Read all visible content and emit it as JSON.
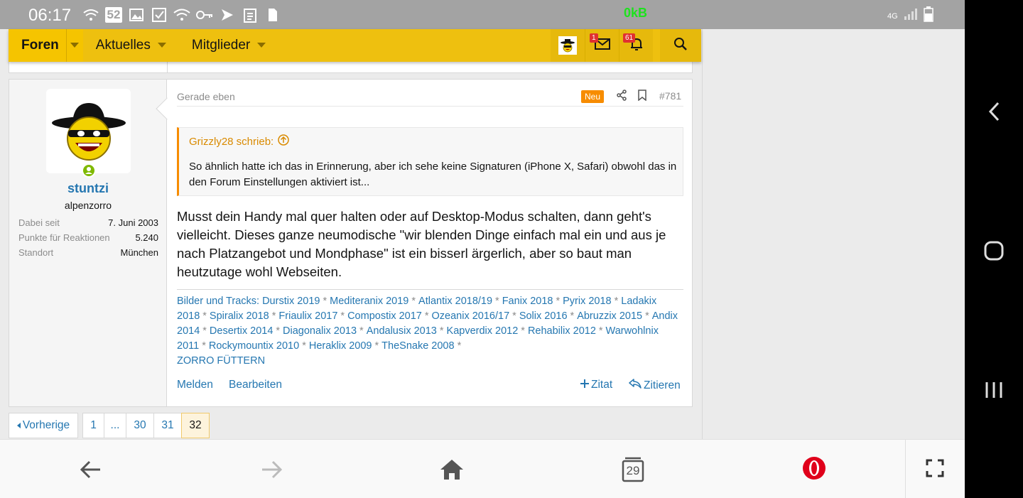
{
  "status_bar": {
    "time": "06:17",
    "notif_badge": "52",
    "net_speed": "0kB",
    "net_type": "4G",
    "icons": [
      "wifi-icon",
      "image-icon",
      "check-icon",
      "wifi-alt-icon",
      "key-icon",
      "send-icon",
      "clipboard-icon",
      "sim-icon"
    ]
  },
  "forum_nav": {
    "items": [
      {
        "label": "Foren"
      },
      {
        "label": "Aktuelles"
      },
      {
        "label": "Mitglieder"
      }
    ],
    "inbox_badge": "1",
    "alerts_badge": "61"
  },
  "post": {
    "date": "Gerade eben",
    "new_badge": "Neu",
    "post_number": "#781",
    "user": {
      "name": "stuntzi",
      "title": "alpenzorro",
      "extras": [
        {
          "key": "Dabei seit",
          "value": "7. Juni 2003"
        },
        {
          "key": "Punkte für Reaktionen",
          "value": "5.240"
        },
        {
          "key": "Standort",
          "value": "München"
        }
      ]
    },
    "quote": {
      "author_line": "Grizzly28 schrieb:",
      "text": "So ähnlich hatte ich das in Erinnerung, aber ich sehe keine Signaturen (iPhone X, Safari) obwohl das in den Forum Einstellungen aktiviert ist..."
    },
    "body": "Musst dein Handy mal quer halten oder auf Desktop-Modus schalten, dann geht's vielleicht. Dieses ganze neumodische \"wir blenden Dinge einfach mal ein und aus je nach Platzangebot und Mondphase\" ist ein bisserl ärgerlich, aber so baut man heutzutage wohl Webseiten.",
    "signature_links": [
      "Bilder und Tracks: Durstix 2019",
      "Mediteranix 2019",
      "Atlantix 2018/19",
      "Fanix 2018",
      "Pyrix 2018",
      "Ladakix 2018",
      "Spiralix 2018",
      "Friaulix 2017",
      "Compostix 2017",
      "Ozeanix 2016/17",
      "Solix 2016",
      "Abruzzix 2015",
      "Andix 2014",
      "Desertix 2014",
      "Diagonalix 2013",
      "Andalusix 2013",
      "Kapverdix 2012",
      "Rehabilix 2012",
      "Warwohlnix 2011",
      "Rockymountix 2010",
      "Heraklix 2009",
      "TheSnake 2008"
    ],
    "signature_separator": "*",
    "signature_last": "ZORRO FÜTTERN",
    "actions": {
      "report": "Melden",
      "edit": "Bearbeiten",
      "multiquote": "Zitat",
      "reply": "Zitieren"
    }
  },
  "pagination": {
    "prev": "Vorherige",
    "pages": [
      "1",
      "...",
      "30",
      "31",
      "32"
    ],
    "current": "32"
  },
  "browser_bar": {
    "tabs_count": "29"
  },
  "colors": {
    "nav_bg": "#eec00f",
    "link": "#2577b1",
    "quote_accent": "#f78c00",
    "badge_red": "#e03030"
  }
}
